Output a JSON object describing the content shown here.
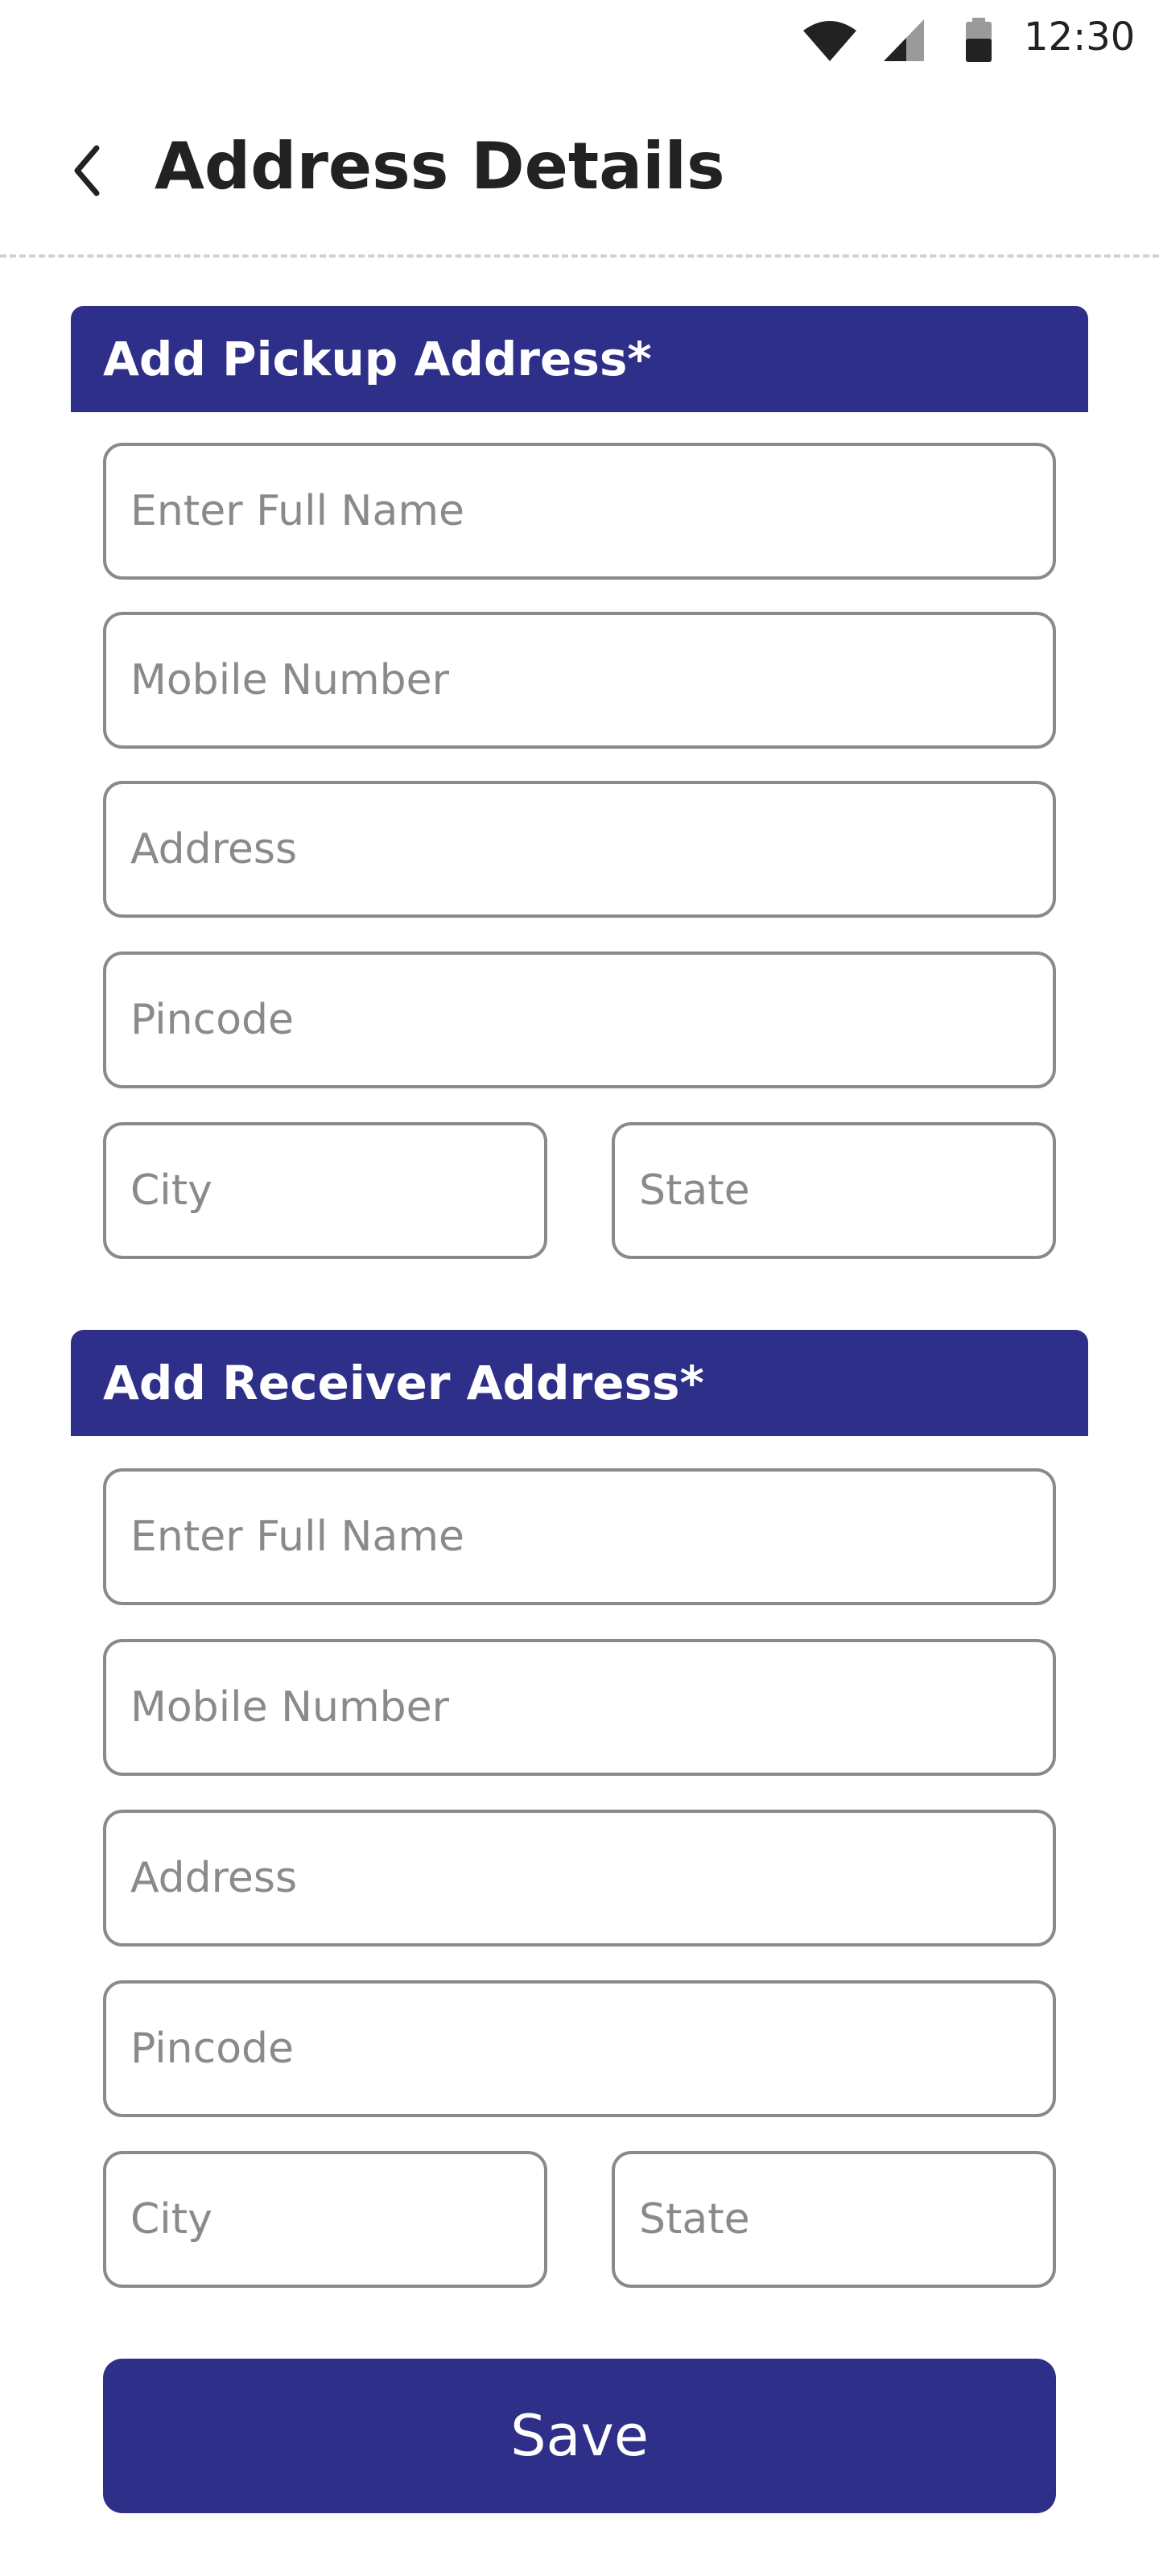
{
  "status_bar": {
    "time": "12:30"
  },
  "header": {
    "title": "Address Details"
  },
  "pickup": {
    "title": "Add Pickup Address*",
    "full_name_placeholder": "Enter Full Name",
    "mobile_placeholder": "Mobile Number",
    "address_placeholder": "Address",
    "pincode_placeholder": "Pincode",
    "city_placeholder": "City",
    "state_placeholder": "State"
  },
  "receiver": {
    "title": "Add Receiver Address*",
    "full_name_placeholder": "Enter Full Name",
    "mobile_placeholder": "Mobile Number",
    "address_placeholder": "Address",
    "pincode_placeholder": "Pincode",
    "city_placeholder": "City",
    "state_placeholder": "State"
  },
  "actions": {
    "save_label": "Save"
  },
  "colors": {
    "primary": "#2e2f88",
    "field_border": "#8a8a8a"
  }
}
